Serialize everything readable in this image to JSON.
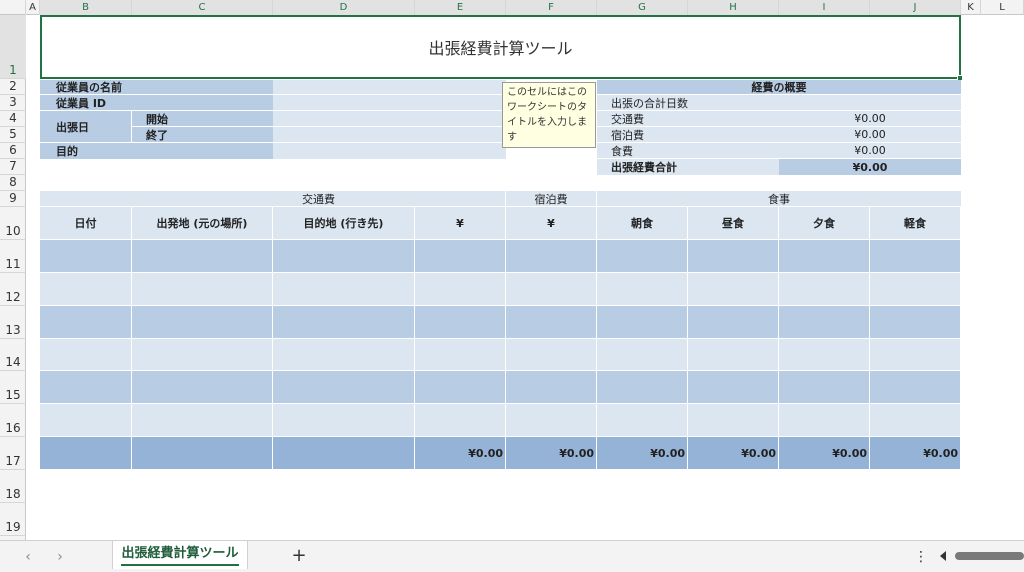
{
  "columns": [
    "A",
    "B",
    "C",
    "D",
    "E",
    "F",
    "G",
    "H",
    "I",
    "J",
    "K",
    "L"
  ],
  "rows": [
    "1",
    "2",
    "3",
    "4",
    "5",
    "6",
    "7",
    "8",
    "9",
    "10",
    "11",
    "12",
    "13",
    "14",
    "15",
    "16",
    "17",
    "18",
    "19"
  ],
  "title": "出張経費計算ツール",
  "employee": {
    "name_label": "従業員の名前",
    "id_label": "従業員 ID",
    "trip_date_label": "出張日",
    "start_label": "開始",
    "end_label": "終了",
    "purpose_label": "目的"
  },
  "tooltip": "このセルにはこのワークシートのタイトルを入力します",
  "summary": {
    "heading": "経費の概要",
    "total_days_label": "出張の合計日数",
    "transport_label": "交通費",
    "transport_value": "¥0.00",
    "lodging_label": "宿泊費",
    "lodging_value": "¥0.00",
    "meals_label": "食費",
    "meals_value": "¥0.00",
    "total_label": "出張経費合計",
    "total_value": "¥0.00"
  },
  "table": {
    "group_transport": "交通費",
    "group_lodging": "宿泊費",
    "group_meals": "食事",
    "headers": [
      "日付",
      "出発地 (元の場所)",
      "目的地 (行き先)",
      "¥",
      "¥",
      "朝食",
      "昼食",
      "夕食",
      "軽食"
    ],
    "totals": [
      "¥0.00",
      "¥0.00",
      "¥0.00",
      "¥0.00",
      "¥0.00",
      "¥0.00"
    ]
  },
  "sheet_tab": "出張経費計算ツール",
  "add_sheet": "+",
  "more": "⋮"
}
